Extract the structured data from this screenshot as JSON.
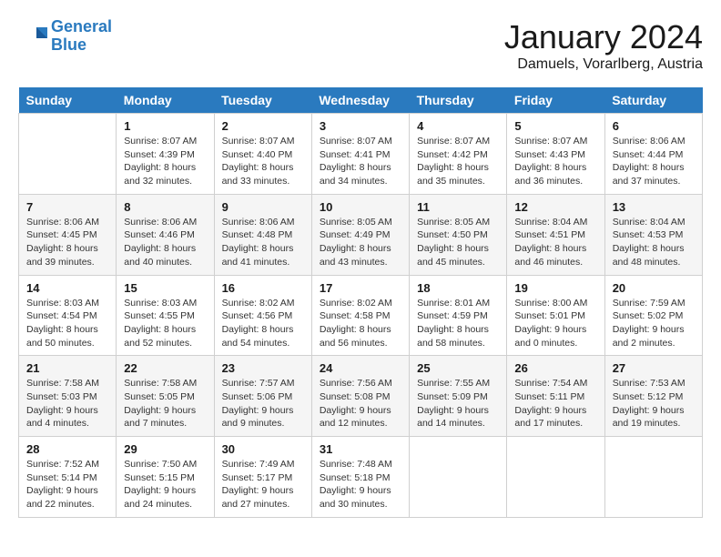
{
  "header": {
    "logo_line1": "General",
    "logo_line2": "Blue",
    "month_title": "January 2024",
    "location": "Damuels, Vorarlberg, Austria"
  },
  "days_of_week": [
    "Sunday",
    "Monday",
    "Tuesday",
    "Wednesday",
    "Thursday",
    "Friday",
    "Saturday"
  ],
  "weeks": [
    [
      {
        "day": "",
        "info": ""
      },
      {
        "day": "1",
        "info": "Sunrise: 8:07 AM\nSunset: 4:39 PM\nDaylight: 8 hours\nand 32 minutes."
      },
      {
        "day": "2",
        "info": "Sunrise: 8:07 AM\nSunset: 4:40 PM\nDaylight: 8 hours\nand 33 minutes."
      },
      {
        "day": "3",
        "info": "Sunrise: 8:07 AM\nSunset: 4:41 PM\nDaylight: 8 hours\nand 34 minutes."
      },
      {
        "day": "4",
        "info": "Sunrise: 8:07 AM\nSunset: 4:42 PM\nDaylight: 8 hours\nand 35 minutes."
      },
      {
        "day": "5",
        "info": "Sunrise: 8:07 AM\nSunset: 4:43 PM\nDaylight: 8 hours\nand 36 minutes."
      },
      {
        "day": "6",
        "info": "Sunrise: 8:06 AM\nSunset: 4:44 PM\nDaylight: 8 hours\nand 37 minutes."
      }
    ],
    [
      {
        "day": "7",
        "info": "Sunrise: 8:06 AM\nSunset: 4:45 PM\nDaylight: 8 hours\nand 39 minutes."
      },
      {
        "day": "8",
        "info": "Sunrise: 8:06 AM\nSunset: 4:46 PM\nDaylight: 8 hours\nand 40 minutes."
      },
      {
        "day": "9",
        "info": "Sunrise: 8:06 AM\nSunset: 4:48 PM\nDaylight: 8 hours\nand 41 minutes."
      },
      {
        "day": "10",
        "info": "Sunrise: 8:05 AM\nSunset: 4:49 PM\nDaylight: 8 hours\nand 43 minutes."
      },
      {
        "day": "11",
        "info": "Sunrise: 8:05 AM\nSunset: 4:50 PM\nDaylight: 8 hours\nand 45 minutes."
      },
      {
        "day": "12",
        "info": "Sunrise: 8:04 AM\nSunset: 4:51 PM\nDaylight: 8 hours\nand 46 minutes."
      },
      {
        "day": "13",
        "info": "Sunrise: 8:04 AM\nSunset: 4:53 PM\nDaylight: 8 hours\nand 48 minutes."
      }
    ],
    [
      {
        "day": "14",
        "info": "Sunrise: 8:03 AM\nSunset: 4:54 PM\nDaylight: 8 hours\nand 50 minutes."
      },
      {
        "day": "15",
        "info": "Sunrise: 8:03 AM\nSunset: 4:55 PM\nDaylight: 8 hours\nand 52 minutes."
      },
      {
        "day": "16",
        "info": "Sunrise: 8:02 AM\nSunset: 4:56 PM\nDaylight: 8 hours\nand 54 minutes."
      },
      {
        "day": "17",
        "info": "Sunrise: 8:02 AM\nSunset: 4:58 PM\nDaylight: 8 hours\nand 56 minutes."
      },
      {
        "day": "18",
        "info": "Sunrise: 8:01 AM\nSunset: 4:59 PM\nDaylight: 8 hours\nand 58 minutes."
      },
      {
        "day": "19",
        "info": "Sunrise: 8:00 AM\nSunset: 5:01 PM\nDaylight: 9 hours\nand 0 minutes."
      },
      {
        "day": "20",
        "info": "Sunrise: 7:59 AM\nSunset: 5:02 PM\nDaylight: 9 hours\nand 2 minutes."
      }
    ],
    [
      {
        "day": "21",
        "info": "Sunrise: 7:58 AM\nSunset: 5:03 PM\nDaylight: 9 hours\nand 4 minutes."
      },
      {
        "day": "22",
        "info": "Sunrise: 7:58 AM\nSunset: 5:05 PM\nDaylight: 9 hours\nand 7 minutes."
      },
      {
        "day": "23",
        "info": "Sunrise: 7:57 AM\nSunset: 5:06 PM\nDaylight: 9 hours\nand 9 minutes."
      },
      {
        "day": "24",
        "info": "Sunrise: 7:56 AM\nSunset: 5:08 PM\nDaylight: 9 hours\nand 12 minutes."
      },
      {
        "day": "25",
        "info": "Sunrise: 7:55 AM\nSunset: 5:09 PM\nDaylight: 9 hours\nand 14 minutes."
      },
      {
        "day": "26",
        "info": "Sunrise: 7:54 AM\nSunset: 5:11 PM\nDaylight: 9 hours\nand 17 minutes."
      },
      {
        "day": "27",
        "info": "Sunrise: 7:53 AM\nSunset: 5:12 PM\nDaylight: 9 hours\nand 19 minutes."
      }
    ],
    [
      {
        "day": "28",
        "info": "Sunrise: 7:52 AM\nSunset: 5:14 PM\nDaylight: 9 hours\nand 22 minutes."
      },
      {
        "day": "29",
        "info": "Sunrise: 7:50 AM\nSunset: 5:15 PM\nDaylight: 9 hours\nand 24 minutes."
      },
      {
        "day": "30",
        "info": "Sunrise: 7:49 AM\nSunset: 5:17 PM\nDaylight: 9 hours\nand 27 minutes."
      },
      {
        "day": "31",
        "info": "Sunrise: 7:48 AM\nSunset: 5:18 PM\nDaylight: 9 hours\nand 30 minutes."
      },
      {
        "day": "",
        "info": ""
      },
      {
        "day": "",
        "info": ""
      },
      {
        "day": "",
        "info": ""
      }
    ]
  ]
}
